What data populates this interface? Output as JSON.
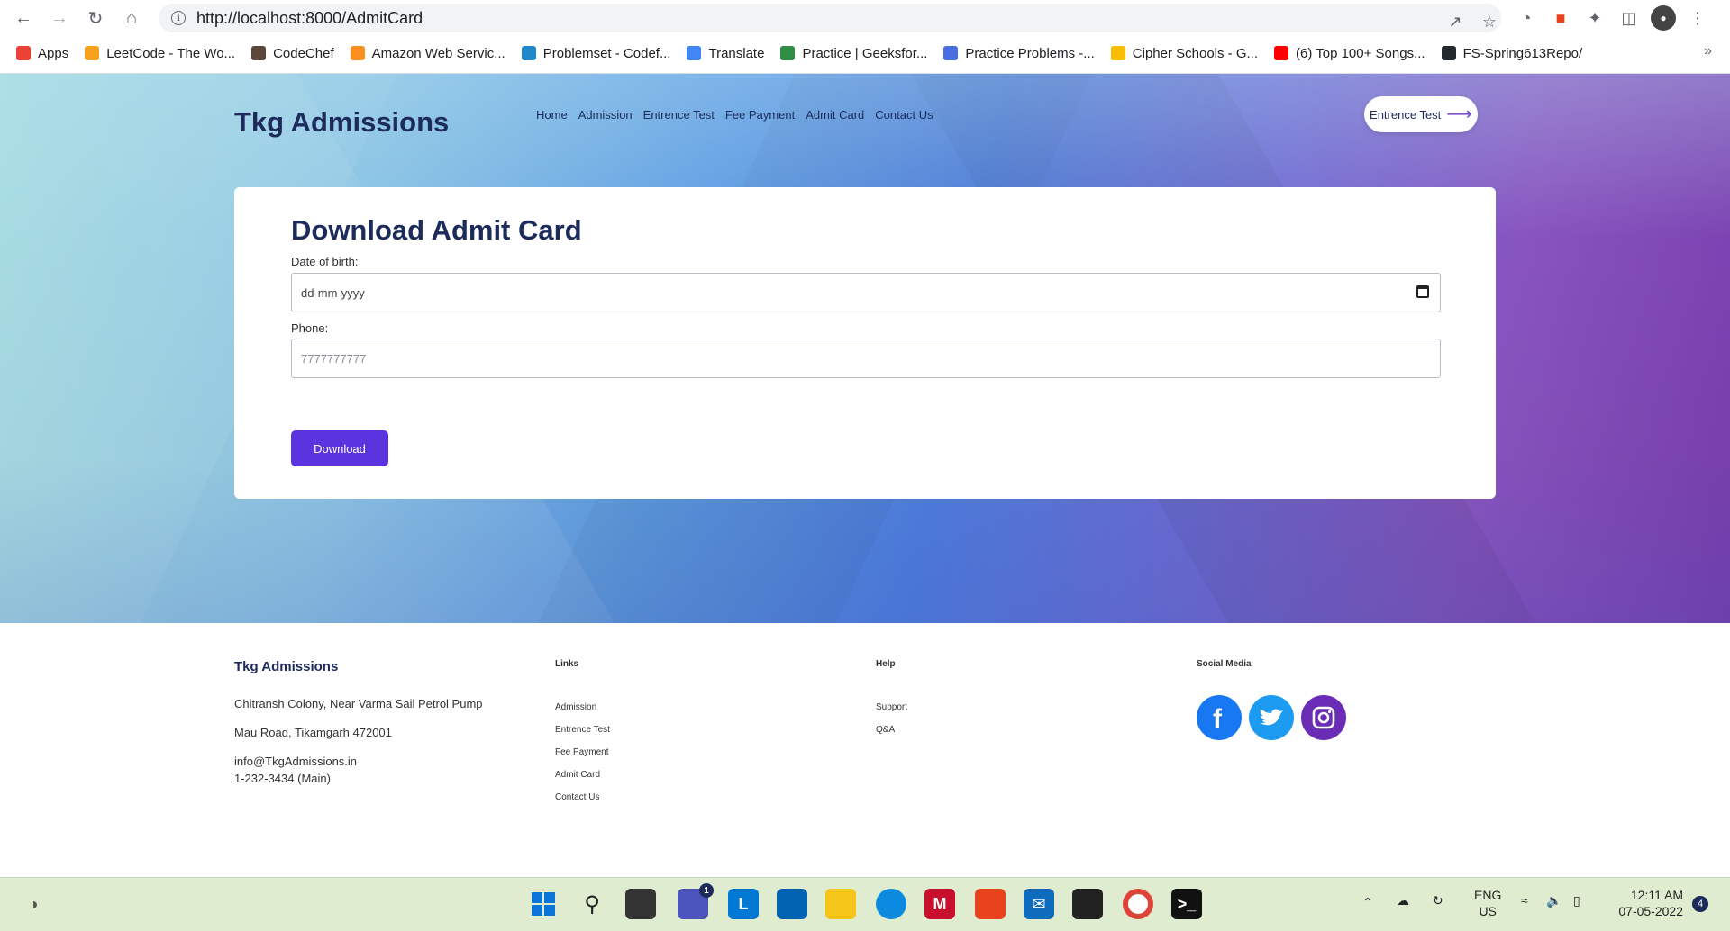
{
  "browser": {
    "url": "http://localhost:8000/AdmitCard",
    "bookmarks": [
      {
        "label": "Apps",
        "color": "#ea4335"
      },
      {
        "label": "LeetCode - The Wo...",
        "color": "#f89f1b"
      },
      {
        "label": "CodeChef",
        "color": "#5b4638"
      },
      {
        "label": "Amazon Web Servic...",
        "color": "#f7901e"
      },
      {
        "label": "Problemset - Codef...",
        "color": "#1f8acb"
      },
      {
        "label": "Translate",
        "color": "#4285f4"
      },
      {
        "label": "Practice | Geeksfor...",
        "color": "#2f8d46"
      },
      {
        "label": "Practice Problems -...",
        "color": "#4a6ee0"
      },
      {
        "label": "Cipher Schools - G...",
        "color": "#fbbc04"
      },
      {
        "label": "(6) Top 100+ Songs...",
        "color": "#ff0000"
      },
      {
        "label": "FS-Spring613Repo/",
        "color": "#24292e"
      }
    ],
    "more": "»"
  },
  "site": {
    "brand": "Tkg Admissions",
    "nav": [
      "Home",
      "Admission",
      "Entrence Test",
      "Fee Payment",
      "Admit Card",
      "Contact Us"
    ],
    "cta_label": "Entrence Test"
  },
  "form": {
    "title": "Download Admit Card",
    "dob_label": "Date of birth:",
    "dob_value": "dd-mm-yyyy",
    "phone_label": "Phone:",
    "phone_placeholder": "7777777777",
    "submit_label": "Download"
  },
  "footer": {
    "brand": "Tkg Admissions",
    "address_line1": "Chitransh Colony, Near Varma Sail Petrol Pump",
    "address_line2": "Mau Road, Tikamgarh 472001",
    "email": "info@TkgAdmissions.in",
    "phone": "1-232-3434 (Main)",
    "links_title": "Links",
    "links": [
      "Admission",
      "Entrence Test",
      "Fee Payment",
      "Admit Card",
      "Contact Us"
    ],
    "help_title": "Help",
    "help": [
      "Support",
      "Q&A"
    ],
    "social_title": "Social Media",
    "social": [
      {
        "name": "facebook-icon",
        "color": "#1877f2"
      },
      {
        "name": "twitter-icon",
        "color": "#1d9bf0"
      },
      {
        "name": "instagram-icon",
        "color": "#6a2bb5"
      }
    ]
  },
  "taskbar": {
    "lang_line1": "ENG",
    "lang_line2": "US",
    "time": "12:11 AM",
    "date": "07-05-2022",
    "notifications": "4",
    "teams_badge": "1"
  }
}
